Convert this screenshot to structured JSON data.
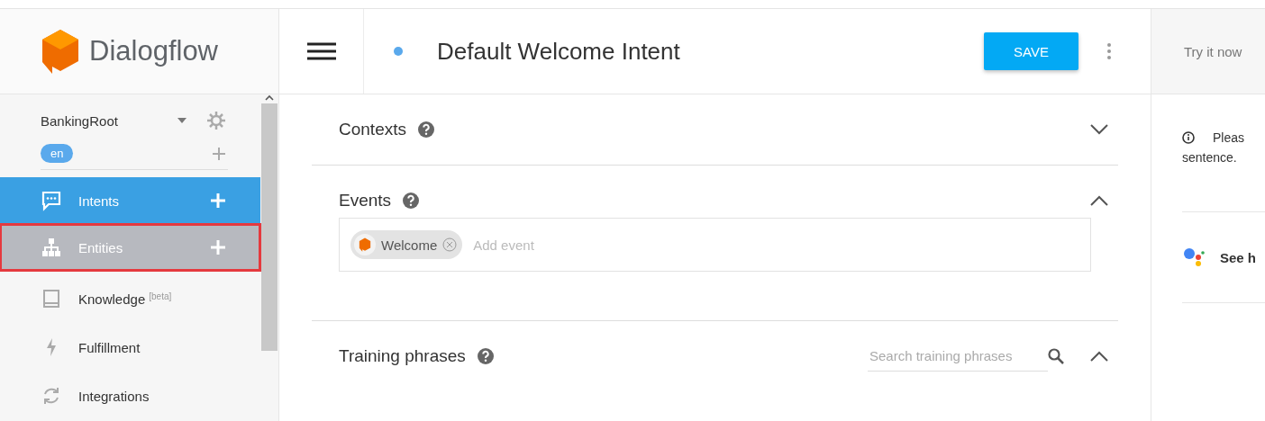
{
  "sidebar": {
    "logo": "Dialogflow",
    "agent": "BankingRoot",
    "language": "en",
    "items": [
      {
        "kind": "intents",
        "label": "Intents",
        "selected": true,
        "highlighted": false,
        "add": true
      },
      {
        "kind": "entities",
        "label": "Entities",
        "selected": false,
        "highlighted": true,
        "add": true
      },
      {
        "kind": "knowledge",
        "label": "Knowledge",
        "badge": "[beta]",
        "selected": false,
        "highlighted": false,
        "add": false
      },
      {
        "kind": "fulfillment",
        "label": "Fulfillment",
        "selected": false,
        "highlighted": false,
        "add": false
      },
      {
        "kind": "integrations",
        "label": "Integrations",
        "selected": false,
        "highlighted": false,
        "add": false
      }
    ]
  },
  "header": {
    "title": "Default Welcome Intent",
    "save": "SAVE"
  },
  "sections": [
    {
      "kind": "contexts",
      "title": "Contexts",
      "expanded": false
    },
    {
      "kind": "events",
      "title": "Events",
      "expanded": true,
      "chips": [
        "Welcome"
      ],
      "placeholder": "Add event"
    },
    {
      "kind": "training",
      "title": "Training phrases",
      "expanded": true,
      "search_placeholder": "Search training phrases"
    }
  ],
  "console": {
    "title": "Try it now",
    "notice_start": "Pleas",
    "notice_end": "sentence.",
    "assistant_link": "See h"
  }
}
